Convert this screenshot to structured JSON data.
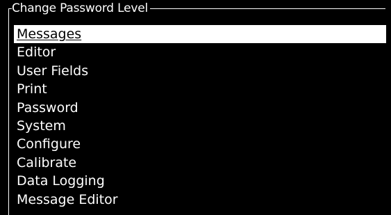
{
  "dialog": {
    "title": "Change Password Level"
  },
  "menu": {
    "selected_index": 0,
    "items": [
      {
        "label": "Messages"
      },
      {
        "label": "Editor"
      },
      {
        "label": "User Fields"
      },
      {
        "label": "Print"
      },
      {
        "label": "Password"
      },
      {
        "label": "System"
      },
      {
        "label": "Configure"
      },
      {
        "label": "Calibrate"
      },
      {
        "label": "Data Logging"
      },
      {
        "label": "Message Editor"
      }
    ]
  },
  "colors": {
    "background": "#000000",
    "foreground": "#ffffff",
    "highlight": "#ffffff"
  }
}
